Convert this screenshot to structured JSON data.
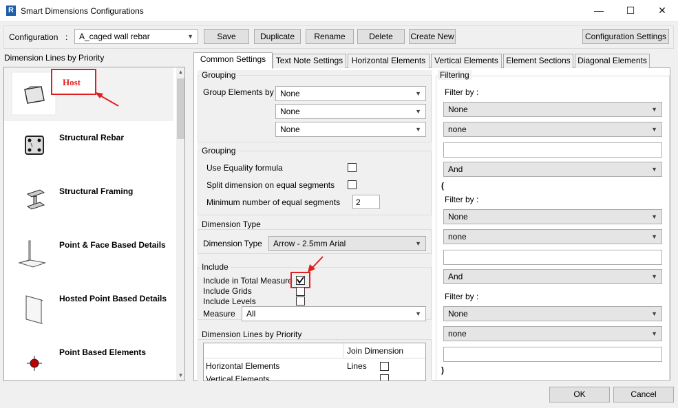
{
  "window": {
    "title": "Smart Dimensions Configurations",
    "app_icon": "R",
    "controls": [
      "—",
      "☐",
      "✕"
    ]
  },
  "toolbar": {
    "config_label": "Configuration",
    "config_sep": ":",
    "config_value": "A_caged wall rebar",
    "save": "Save",
    "duplicate": "Duplicate",
    "rename": "Rename",
    "delete": "Delete",
    "create_new": "Create New",
    "config_settings": "Configuration Settings"
  },
  "left_panel": {
    "title": "Dimension Lines by Priority",
    "items": [
      {
        "label": "Host",
        "icon": "wall-host-icon"
      },
      {
        "label": "Structural Rebar",
        "icon": "rebar-section-icon"
      },
      {
        "label": "Structural Framing",
        "icon": "steel-beam-icon"
      },
      {
        "label": "Point & Face Based Details",
        "icon": "face-detail-icon"
      },
      {
        "label": "Hosted Point Based Details",
        "icon": "panel-detail-icon"
      },
      {
        "label": "Point Based Elements",
        "icon": "point-element-icon"
      }
    ]
  },
  "tabs": [
    "Common Settings",
    "Text Note Settings",
    "Horizontal Elements",
    "Vertical Elements",
    "Element Sections",
    "Diagonal Elements"
  ],
  "grouping1": {
    "title": "Grouping",
    "group_by_label": "Group Elements by",
    "values": [
      "None",
      "None",
      "None"
    ]
  },
  "grouping2": {
    "title": "Grouping",
    "equality_label": "Use Equality formula",
    "split_label": "Split dimension on equal segments",
    "min_label": "Minimum number of equal segments",
    "min_value": "2"
  },
  "dimension_type": {
    "title": "Dimension Type",
    "label": "Dimension Type",
    "value": "Arrow - 2.5mm Arial"
  },
  "include": {
    "title": "Include",
    "total_measure": "Include in Total Measure",
    "grids": "Include Grids",
    "levels": "Include Levels",
    "measure_label": "Measure",
    "measure_value": "All",
    "total_measure_checked": true
  },
  "priority_table": {
    "title": "Dimension Lines by Priority",
    "col_header": "Join Dimension Lines",
    "rows": [
      "Horizontal Elements",
      "Vertical Elements"
    ]
  },
  "filtering": {
    "title": "Filtering",
    "filter_by_1": "Filter by :",
    "f1_a": "None",
    "f1_b": "none",
    "f1_text": "",
    "and_1": "And",
    "open_paren": "(",
    "filter_by_2": "Filter by :",
    "f2_a": "None",
    "f2_b": "none",
    "f2_text": "",
    "and_2": "And",
    "filter_by_3": "Filter by :",
    "f3_a": "None",
    "f3_b": "none",
    "f3_text": "",
    "close_paren": ")"
  },
  "footer": {
    "ok": "OK",
    "cancel": "Cancel"
  },
  "colors": {
    "accent_red": "#e02020",
    "selected_row": "#f2f2f2"
  }
}
